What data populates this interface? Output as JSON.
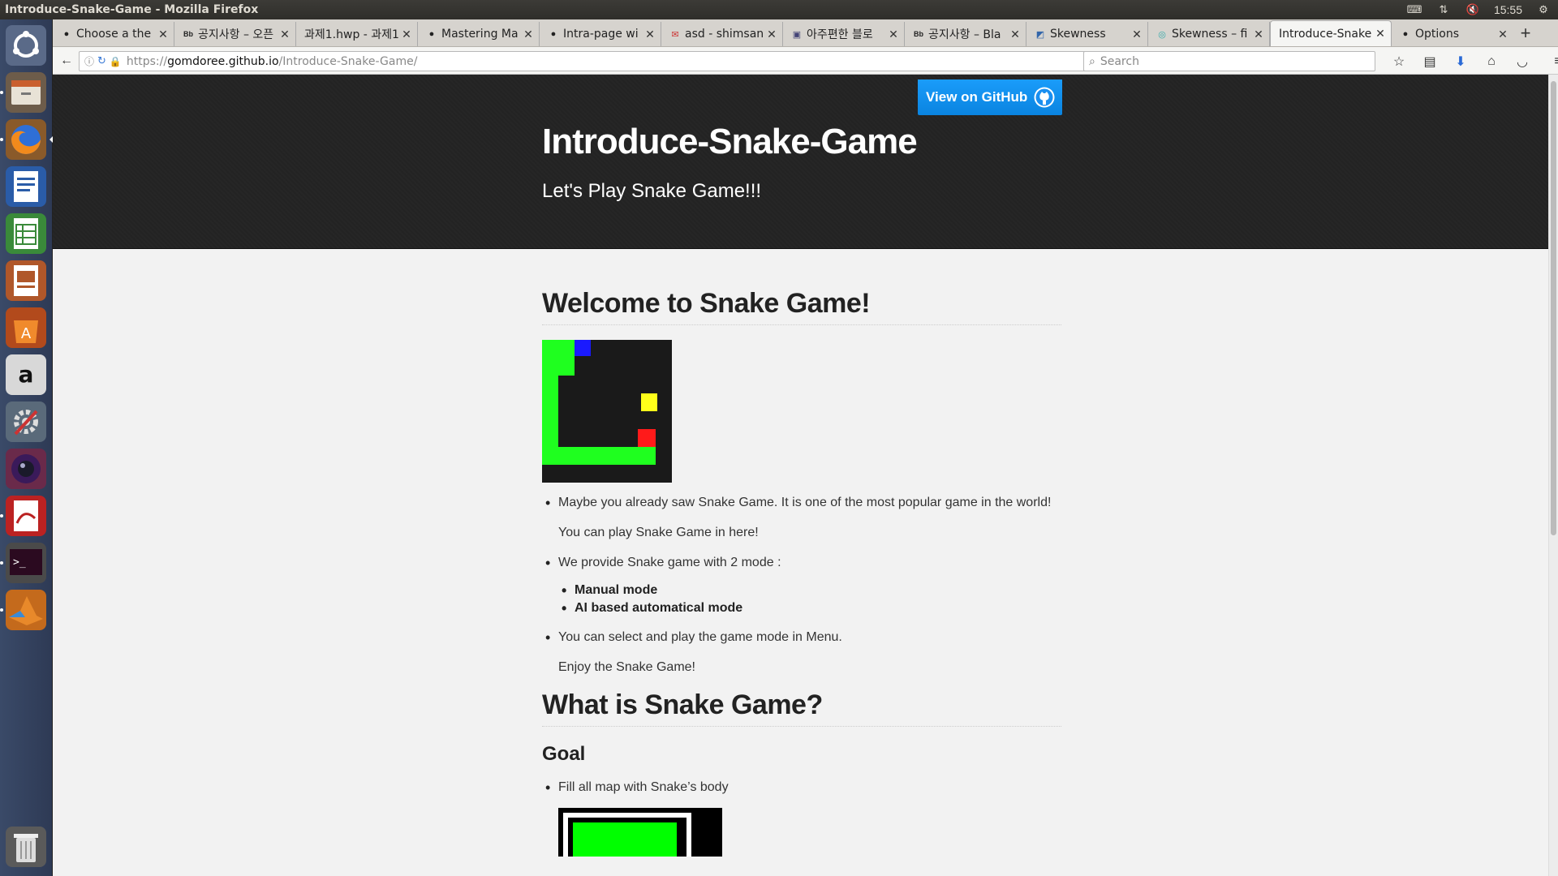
{
  "window": {
    "title": "Introduce-Snake-Game - Mozilla Firefox"
  },
  "panel": {
    "time": "15:55"
  },
  "tabs": [
    {
      "label": "Choose a the",
      "favicon": "github-icon"
    },
    {
      "label": "공지사항 – 오픈",
      "favicon": "blackboard-icon"
    },
    {
      "label": "과제1.hwp - 과제1",
      "favicon": "none"
    },
    {
      "label": "Mastering Ma",
      "favicon": "github-icon"
    },
    {
      "label": "Intra-page wi",
      "favicon": "github-icon"
    },
    {
      "label": "asd - shimsan",
      "favicon": "gmail-icon"
    },
    {
      "label": "아주편한 블로",
      "favicon": "blog-icon"
    },
    {
      "label": "공지사항 – Bla",
      "favicon": "blackboard-icon"
    },
    {
      "label": "Skewness",
      "favicon": "document-icon"
    },
    {
      "label": "Skewness – fi",
      "favicon": "web-icon"
    },
    {
      "label": "Introduce-Snake",
      "favicon": "none",
      "active": true
    },
    {
      "label": "Options",
      "favicon": "github-icon"
    }
  ],
  "navbar": {
    "url_protocol": "https://",
    "url_host": "gomdoree.github.io",
    "url_path": "/Introduce-Snake-Game/",
    "search_placeholder": "Search"
  },
  "page": {
    "github_button": "View on GitHub",
    "title": "Introduce-Snake-Game",
    "tagline": "Let's Play Snake Game!!!",
    "welcome_heading": "Welcome to Snake Game!",
    "bullets1": [
      "Maybe you already saw Snake Game. It is one of the most popular game in the world!"
    ],
    "para1": "You can play Snake Game in here!",
    "bullets2": "We provide Snake game with 2 mode :",
    "modes": [
      "Manual mode",
      "AI based automatical mode"
    ],
    "bullets3": "You can select and play the game mode in Menu.",
    "para2": "Enjoy the Snake Game!",
    "what_heading": "What is Snake Game?",
    "goal_heading": "Goal",
    "goal_bullet": "Fill all map with Snake’s body"
  },
  "colors": {
    "header_bg": "#232323",
    "github_button": "#0a8ef0",
    "snake_green": "#1fff1f",
    "snake_head_blue": "#1a1aff",
    "food_yellow": "#ffff1a",
    "obstacle_red": "#ff1a1a",
    "board_bg": "#1a1a1a"
  }
}
